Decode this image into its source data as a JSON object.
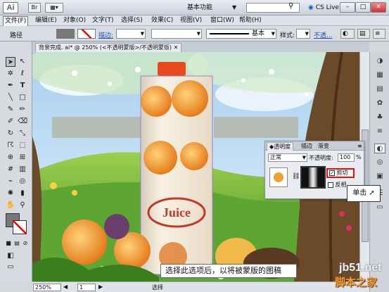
{
  "app": {
    "logo": "Ai",
    "bridge_label": "Br",
    "workspace": "基本功能",
    "cs_live": "CS Live"
  },
  "menu": [
    "文件(F)",
    "编辑(E)",
    "对象(O)",
    "文字(T)",
    "选择(S)",
    "效果(C)",
    "视图(V)",
    "窗口(W)",
    "帮助(H)"
  ],
  "control_bar": {
    "object_type": "路径",
    "stroke_label": "描边:",
    "stroke_profile": "基本",
    "style_label": "样式:",
    "opacity_label": "不透..."
  },
  "document_tab": "背景完成. ai* @ 250% (<不透明蒙版>/不透明蒙版)",
  "transparency_panel": {
    "tabs": [
      "透明度",
      "描边",
      "渐变"
    ],
    "blend_mode": "正常",
    "opacity_label": "不透明度:",
    "opacity_value": "100",
    "opacity_unit": "%",
    "clip_label": "剪切",
    "invert_label": "反相"
  },
  "callout": "单击",
  "caption": "选择此选项后，以将被蒙版的图稿",
  "artwork": {
    "juice_text": "Juice"
  },
  "status_bar": {
    "zoom": "250%",
    "page": "1",
    "tool": "选择"
  },
  "watermark": {
    "domain": "jb51.net",
    "site": "脚本之家"
  },
  "colors": {
    "sky": "#a8cff0",
    "grass": "#6fb43a",
    "tree_trunk": "#6b4a2a",
    "carton": "#f4e9d4",
    "cap": "#e84a1e",
    "highlight": "#e01010"
  }
}
